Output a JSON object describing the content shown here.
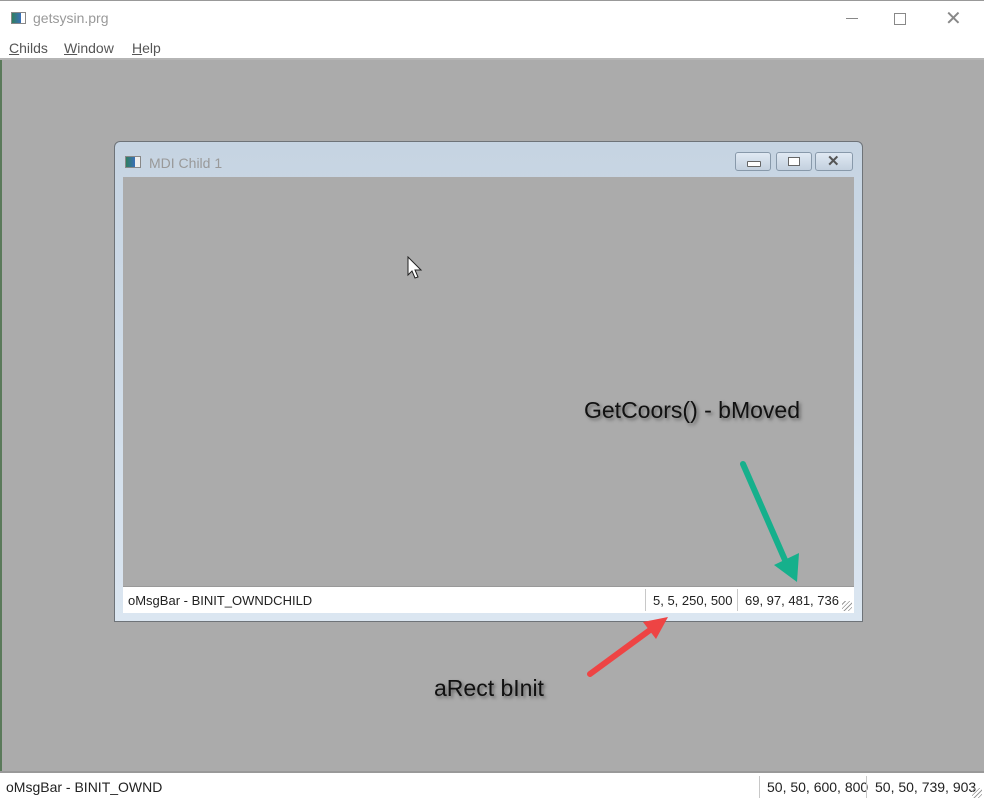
{
  "window": {
    "title": "getsysin.prg",
    "icon": "app-window-icon",
    "controls": [
      "minimize",
      "maximize",
      "close"
    ]
  },
  "menubar": {
    "items": [
      {
        "label_ul": "C",
        "label_rest": "hilds"
      },
      {
        "label_ul": "W",
        "label_rest": "indow"
      },
      {
        "label_ul": "H",
        "label_rest": "elp"
      }
    ]
  },
  "child_window": {
    "title": "MDI Child 1",
    "status": {
      "message": "oMsgBar - BINIT_OWNDCHILD",
      "item_a": "5, 5, 250, 500",
      "item_b": "69, 97, 481, 736"
    }
  },
  "annotations": {
    "green_label": "GetCoors() - bMoved",
    "red_label": "aRect bInit",
    "colors": {
      "green": "#16b08c",
      "red": "#ee4444"
    }
  },
  "main_status": {
    "message": "oMsgBar - BINIT_OWND",
    "item_a": "50, 50, 600, 800",
    "item_b": "50, 50, 739, 903"
  }
}
